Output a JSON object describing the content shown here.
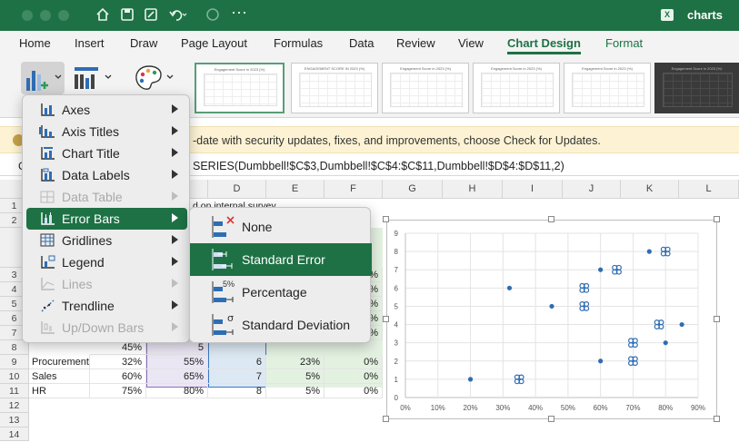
{
  "app": {
    "title": "charts",
    "toolbar_icons": [
      "home-icon",
      "save-icon",
      "edit-icon",
      "undo-icon",
      "redo-icon",
      "more-icon"
    ]
  },
  "tabs": [
    "Home",
    "Insert",
    "Draw",
    "Page Layout",
    "Formulas",
    "Data",
    "Review",
    "View",
    "Chart Design",
    "Format"
  ],
  "active_tab": "Chart Design",
  "chart_styles": [
    {
      "title": "Engagement Score in 2023 (%)",
      "dark": false
    },
    {
      "title": "ENGAGEMENT SCORE IN 2023 (%)",
      "dark": false
    },
    {
      "title": "Engagement Score in 2023 (%)",
      "dark": false
    },
    {
      "title": "Engagement Score in 2023 (%)",
      "dark": false
    },
    {
      "title": "Engagement Score in 2023 (%)",
      "dark": false
    },
    {
      "title": "Engagement Score in 2023 (%)",
      "dark": true
    }
  ],
  "infobar": {
    "text": "-date with security updates, fixes, and improvements, choose Check for Updates."
  },
  "formula_bar": {
    "name_box": "C",
    "formula": "SERIES(Dumbbell!$C$3,Dumbbell!$C$4:$C$11,Dumbbell!$D$4:$D$11,2)"
  },
  "columns": [
    "D",
    "E",
    "F",
    "G",
    "H",
    "I",
    "J",
    "K",
    "L"
  ],
  "rows": [
    "1",
    "2",
    "",
    "3",
    "4",
    "5",
    "6",
    "7",
    "8",
    "9",
    "10",
    "11",
    "12",
    "13",
    "14"
  ],
  "sheet": {
    "header_fragment": "d on internal survey",
    "row8_fragment": "45%",
    "row8_c": "5",
    "percent_col_f": [
      "0%",
      "0%",
      "0%",
      "0%",
      "0%"
    ],
    "data_rows": [
      {
        "name": "Procurement",
        "b": "32%",
        "c": "55%",
        "d": "6",
        "e": "23%",
        "f": "0%"
      },
      {
        "name": "Sales",
        "b": "60%",
        "c": "65%",
        "d": "7",
        "e": "5%",
        "f": "0%"
      },
      {
        "name": "HR",
        "b": "75%",
        "c": "80%",
        "d": "8",
        "e": "5%",
        "f": "0%"
      }
    ]
  },
  "chart_data": {
    "type": "scatter",
    "title": "",
    "xlabel": "",
    "ylabel": "",
    "xlim": [
      0,
      0.9
    ],
    "ylim": [
      0,
      9
    ],
    "x_ticks": [
      "0%",
      "10%",
      "20%",
      "30%",
      "40%",
      "50%",
      "60%",
      "70%",
      "80%",
      "90%"
    ],
    "y_ticks": [
      "0",
      "1",
      "2",
      "3",
      "4",
      "5",
      "6",
      "7",
      "8",
      "9"
    ],
    "grid": true,
    "series": [
      {
        "x": [
          0.2,
          0.32,
          0.45,
          0.6,
          0.6,
          0.75,
          0.8,
          0.85
        ],
        "y": [
          1,
          6,
          5,
          2,
          7,
          8,
          3,
          4
        ],
        "marker": "dot"
      },
      {
        "x": [
          0.35,
          0.55,
          0.55,
          0.65,
          0.7,
          0.7,
          0.78,
          0.8
        ],
        "y": [
          1,
          6,
          5,
          7,
          2,
          3,
          4,
          8
        ],
        "marker": "error-bar"
      }
    ]
  },
  "chart_elements_menu": {
    "items": [
      {
        "label": "Axes",
        "enabled": true,
        "icon": "axes-icon"
      },
      {
        "label": "Axis Titles",
        "enabled": true,
        "icon": "axis-titles-icon"
      },
      {
        "label": "Chart Title",
        "enabled": true,
        "icon": "chart-title-icon"
      },
      {
        "label": "Data Labels",
        "enabled": true,
        "icon": "data-labels-icon"
      },
      {
        "label": "Data Table",
        "enabled": false,
        "icon": "data-table-icon"
      },
      {
        "label": "Error Bars",
        "enabled": true,
        "highlighted": true,
        "icon": "error-bars-icon"
      },
      {
        "label": "Gridlines",
        "enabled": true,
        "icon": "gridlines-icon"
      },
      {
        "label": "Legend",
        "enabled": true,
        "icon": "legend-icon"
      },
      {
        "label": "Lines",
        "enabled": false,
        "icon": "lines-icon"
      },
      {
        "label": "Trendline",
        "enabled": true,
        "icon": "trendline-icon"
      },
      {
        "label": "Up/Down Bars",
        "enabled": false,
        "icon": "up-down-bars-icon"
      }
    ]
  },
  "error_bars_menu": {
    "items": [
      {
        "label": "None",
        "icon": "none-icon"
      },
      {
        "label": "Standard Error",
        "highlighted": true,
        "icon": "standard-error-icon"
      },
      {
        "label": "Percentage",
        "icon": "percentage-icon",
        "badge": "5%"
      },
      {
        "label": "Standard Deviation",
        "icon": "standard-deviation-icon",
        "badge": "σ"
      }
    ]
  },
  "colors": {
    "accent": "#1e7145",
    "marker": "#2e6db4",
    "info": "#fdf3d4"
  }
}
